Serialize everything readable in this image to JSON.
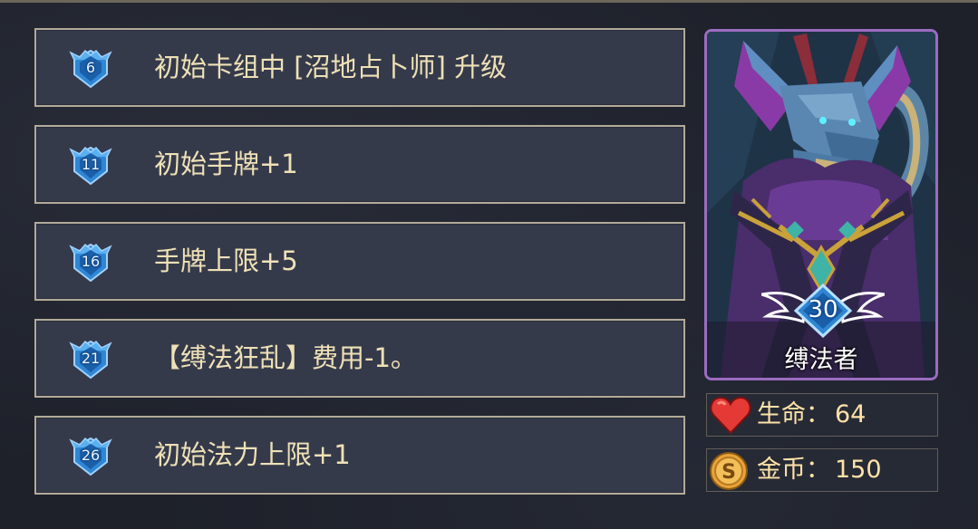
{
  "upgrades": [
    {
      "level": "6",
      "text": "初始卡组中 [沼地占卜师] 升级"
    },
    {
      "level": "11",
      "text": "初始手牌+1"
    },
    {
      "level": "16",
      "text": "手牌上限+5"
    },
    {
      "level": "21",
      "text": "【缚法狂乱】费用-1。"
    },
    {
      "level": "26",
      "text": "初始法力上限+1"
    }
  ],
  "character": {
    "level": "30",
    "class_name": "缚法者"
  },
  "stats": {
    "life": {
      "label": "生命：",
      "value": "64",
      "icon": "heart-icon",
      "color": "#e53935"
    },
    "gold": {
      "label": "金币：",
      "value": "150",
      "icon": "coin-icon",
      "color": "#e8a33a"
    }
  },
  "colors": {
    "accent_text": "#efe1b6",
    "panel_bg": "#353a4b",
    "panel_border": "#b3aa99",
    "portrait_border": "#9b6cc0",
    "badge_blue": "#2f86d4"
  }
}
